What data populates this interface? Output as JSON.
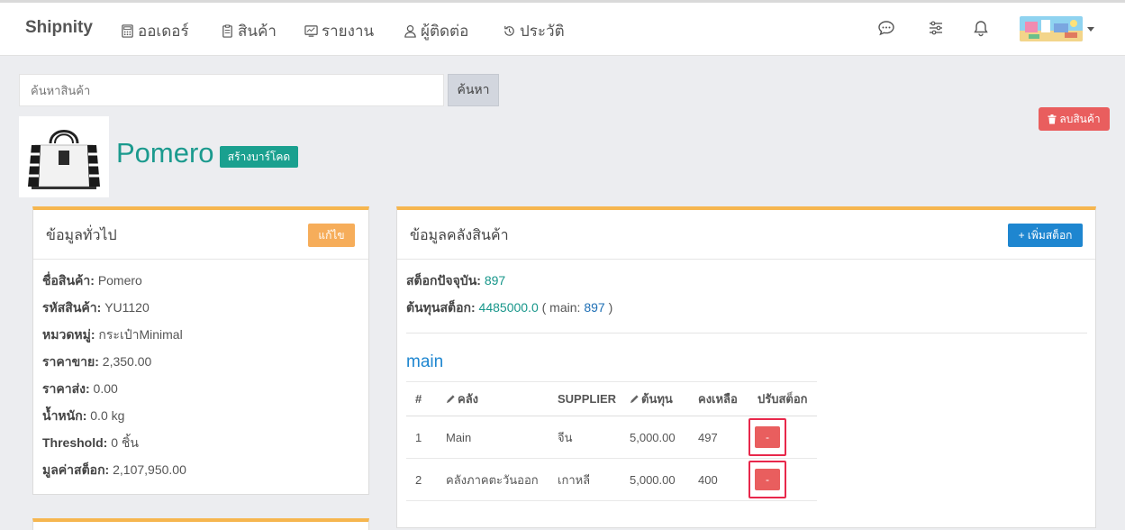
{
  "nav": {
    "brand": "Shipnity",
    "items": [
      {
        "label": "ออเดอร์",
        "icon": "calculator-icon"
      },
      {
        "label": "สินค้า",
        "icon": "clipboard-icon"
      },
      {
        "label": "รายงาน",
        "icon": "monitor-icon"
      },
      {
        "label": "ผู้ติดต่อ",
        "icon": "user-icon"
      },
      {
        "label": "ประวัติ",
        "icon": "history-icon"
      }
    ],
    "right_icons": [
      "chat-icon",
      "sliders-icon",
      "bell-icon"
    ]
  },
  "search": {
    "placeholder": "ค้นหาสินค้า",
    "button": "ค้นหา"
  },
  "delete_button": "ลบสินค้า",
  "product": {
    "name": "Pomero",
    "barcode_button": "สร้างบาร์โคด"
  },
  "general": {
    "title": "ข้อมูลทั่วไป",
    "edit_button": "แก้ไข",
    "rows": [
      {
        "label": "ชื่อสินค้า:",
        "value": "Pomero"
      },
      {
        "label": "รหัสสินค้า:",
        "value": "YU1120"
      },
      {
        "label": "หมวดหมู่:",
        "value": "กระเป๋าMinimal"
      },
      {
        "label": "ราคาขาย:",
        "value": "2,350.00"
      },
      {
        "label": "ราคาส่ง:",
        "value": "0.00"
      },
      {
        "label": "น้ำหนัก:",
        "value": "0.0 kg"
      },
      {
        "label": "Threshold:",
        "value": "0 ชิ้น"
      },
      {
        "label": "มูลค่าสต็อก:",
        "value": "2,107,950.00"
      }
    ]
  },
  "warehouse": {
    "title": "ข้อมูลคลังสินค้า",
    "add_button": "+ เพิ่มสต็อก",
    "current_stock_label": "สต็อกปัจจุบัน:",
    "current_stock_value": "897",
    "cost_label": "ต้นทุนสต็อก:",
    "cost_value": "4485000.0",
    "cost_open": "( main:",
    "cost_main": "897",
    "cost_close": ")",
    "section_title": "main",
    "columns": [
      "#",
      "คลัง",
      "SUPPLIER",
      "ต้นทุน",
      "คงเหลือ",
      "ปรับสต็อก"
    ],
    "rows": [
      {
        "no": "1",
        "warehouse": "Main",
        "supplier": "จีน",
        "cost": "5,000.00",
        "remaining": "497",
        "adjust": "-"
      },
      {
        "no": "2",
        "warehouse": "คลังภาคตะวันออก",
        "supplier": "เกาหลี",
        "cost": "5,000.00",
        "remaining": "400",
        "adjust": "-"
      }
    ]
  },
  "colors": {
    "accent_teal": "#1b9a8e",
    "panel_top": "#f6b64f",
    "primary_blue": "#1e86d0",
    "danger_red": "#e95e5e",
    "highlight_red": "#e8284b"
  }
}
